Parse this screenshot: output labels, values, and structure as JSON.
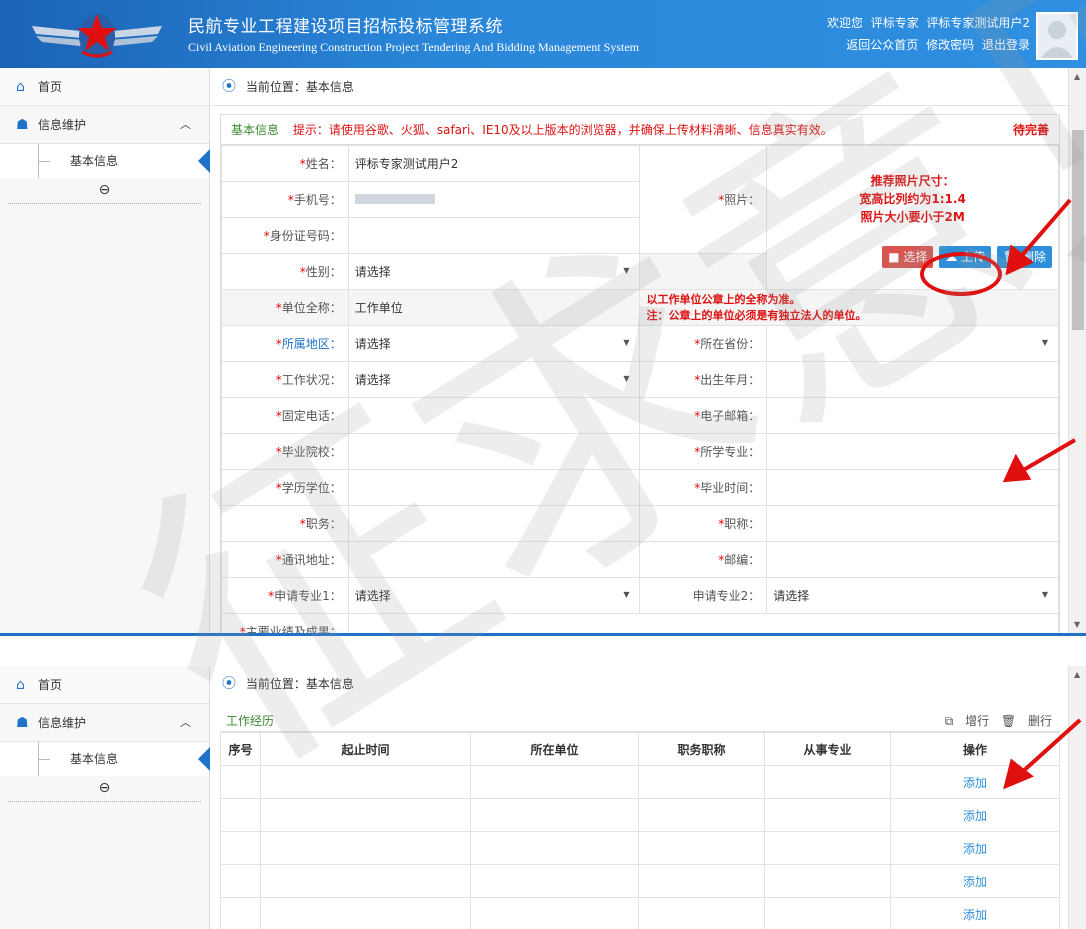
{
  "header": {
    "title_zh": "民航专业工程建设项目招标投标管理系统",
    "title_en": "Civil Aviation Engineering Construction Project Tendering And Bidding Management System",
    "welcome": "欢迎您",
    "role": "评标专家",
    "username": "评标专家测试用户2",
    "links": [
      "返回公众首页",
      "修改密码",
      "退出登录"
    ]
  },
  "sidebar": {
    "home": "首页",
    "group": "信息维护",
    "sub_item": "基本信息"
  },
  "breadcrumb": "当前位置：基本信息",
  "form": {
    "section_label": "基本信息",
    "tip": "提示：请使用谷歌、火狐、safari、IE10及以上版本的浏览器，并确保上传材料清晰、信息真实有效。",
    "status": "待完善",
    "select_placeholder": "请选择",
    "rows": {
      "name_label": "姓名：",
      "name_value": "评标专家测试用户2",
      "phone_label": "手机号：",
      "id_label": "身份证号码：",
      "photo_label": "照片：",
      "gender_label": "性别：",
      "unit_label": "单位全称：",
      "unit_value": "工作单位",
      "unit_note_1": "以工作单位公章上的全称为准。",
      "unit_note_2": "注：公章上的单位必须是有独立法人的单位。",
      "region_label": "所属地区：",
      "province_label": "所在省份：",
      "work_status_label": "工作状况：",
      "birth_label": "出生年月：",
      "tel_label": "固定电话：",
      "email_label": "电子邮箱：",
      "school_label": "毕业院校：",
      "major_label": "所学专业：",
      "degree_label": "学历学位：",
      "grad_time_label": "毕业时间：",
      "post_label": "职务：",
      "title_label": "职称：",
      "address_label": "通讯地址：",
      "zip_label": "邮编：",
      "apply1_label": "申请专业1：",
      "apply2_label": "申请专业2：",
      "achieve_label": "主要业绩及成果："
    },
    "photo_tip_1": "推荐照片尺寸：",
    "photo_tip_2": "宽高比列约为1:1.4",
    "photo_tip_3": "照片大小要小于2M",
    "btn_select": "选择",
    "btn_upload": "上传",
    "btn_delete": "删除"
  },
  "work": {
    "section_label": "工作经历",
    "add_row": "增行",
    "del_row": "删行",
    "columns": [
      "序号",
      "起止时间",
      "所在单位",
      "职务职称",
      "从事专业",
      "操作"
    ],
    "add_link": "添加",
    "row_count": 5
  },
  "watermark": "征求意见",
  "colors": {
    "header": "#1b63b6",
    "accent": "#1e72c8",
    "alert": "#e01010"
  }
}
